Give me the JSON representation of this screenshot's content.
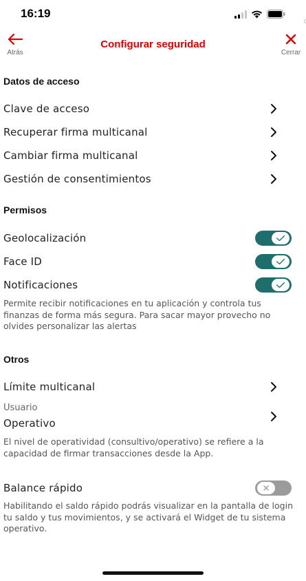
{
  "status_bar": {
    "time": "16:19",
    "icons": [
      "signal-icon",
      "wifi-icon",
      "battery-icon"
    ]
  },
  "nav": {
    "back_label": "Atrás",
    "title": "Configurar seguridad",
    "close_label": "Cerrar",
    "back_icon": "arrow-left-icon",
    "close_icon": "close-icon"
  },
  "sections": {
    "access": {
      "title": "Datos de acceso",
      "items": [
        {
          "label": "Clave de acceso"
        },
        {
          "label": "Recuperar firma multicanal"
        },
        {
          "label": "Cambiar firma multicanal"
        },
        {
          "label": "Gestión de consentimientos"
        }
      ]
    },
    "permissions": {
      "title": "Permisos",
      "items": [
        {
          "label": "Geolocalización",
          "enabled": true
        },
        {
          "label": "Face ID",
          "enabled": true
        },
        {
          "label": "Notificaciones",
          "enabled": true
        }
      ],
      "notifications_description": "Permite recibir notificaciones en tu aplicación y controla tus finanzas de forma más segura. Para sacar mayor provecho no olvides personalizar las alertas"
    },
    "others": {
      "title": "Otros",
      "limit_label": "Límite multicanal",
      "user_label": "Usuario",
      "user_value": "Operativo",
      "operativity_description": "El nivel de operatividad (consultivo/operativo) se refiere a la capacidad de firmar transacciones desde la App.",
      "quick_balance_label": "Balance rápido",
      "quick_balance_enabled": false,
      "quick_balance_description": "Habilitando el saldo rápido podrás visualizar en la pantalla de login tu saldo y tus movimientos, y se activará el Widget de tu sistema operativo."
    }
  },
  "colors": {
    "brand_red": "#e00000",
    "toggle_on": "#1f6e6e",
    "toggle_off": "#9b9b9b"
  }
}
